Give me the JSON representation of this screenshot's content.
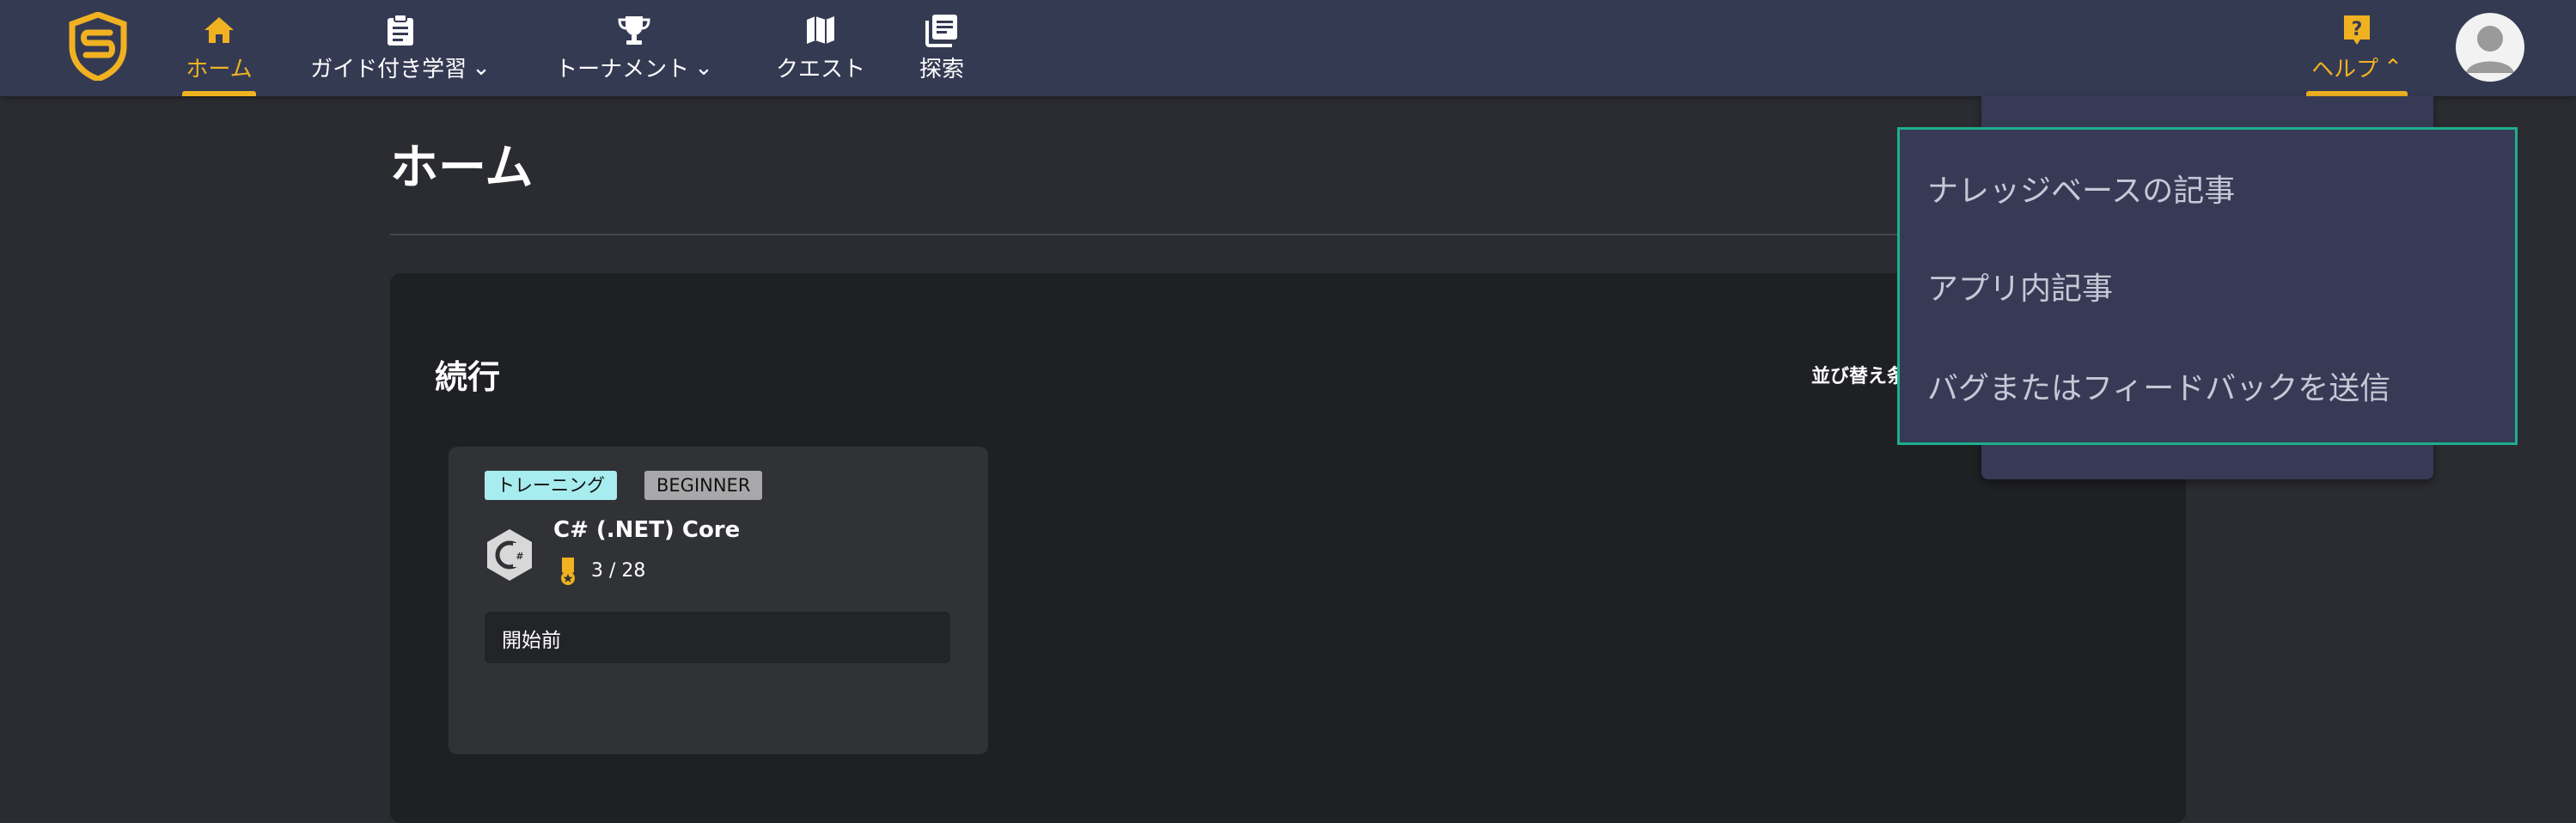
{
  "nav": {
    "items": [
      {
        "label": "ホーム",
        "icon": "home-icon",
        "active": true
      },
      {
        "label": "ガイド付き学習",
        "icon": "clipboard-icon",
        "dropdown": true
      },
      {
        "label": "トーナメント",
        "icon": "trophy-icon",
        "dropdown": true
      },
      {
        "label": "クエスト",
        "icon": "map-icon"
      },
      {
        "label": "探索",
        "icon": "library-icon"
      }
    ],
    "help": {
      "label": "ヘルプ",
      "icon": "help-icon",
      "expanded": true
    }
  },
  "page": {
    "title": "ホーム"
  },
  "section": {
    "title": "続行",
    "sort_label": "並び替え条"
  },
  "card": {
    "tag_type": "トレーニング",
    "tag_level": "BEGINNER",
    "title": "C# (.NET) Core",
    "progress": "3 / 28",
    "status": "開始前"
  },
  "help_menu": {
    "items": [
      "ナレッジベースの記事",
      "アプリ内記事",
      "バグまたはフィードバックを送信"
    ]
  },
  "colors": {
    "accent": "#f1b221",
    "topbar": "#353a53",
    "focus_border": "#1fae8e",
    "tag_training": "#a7ecef"
  }
}
